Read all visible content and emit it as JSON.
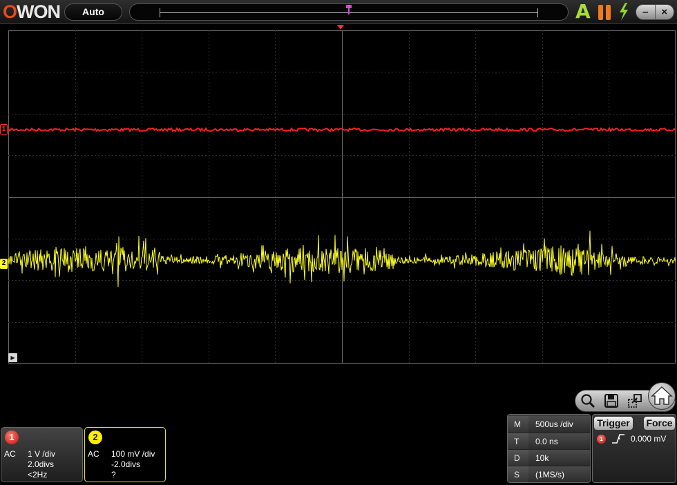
{
  "app": {
    "brand": "OWON"
  },
  "toolbar": {
    "mode_label": "Auto",
    "auto_icon_glyph": "A",
    "minimize_glyph": "–",
    "close_glyph": "×"
  },
  "colors": {
    "ch1": "#ff2020",
    "ch2": "#ffff20",
    "grid": "#2f2f2f",
    "grid_axis": "#6a6a6a",
    "background": "#000000",
    "trigger_marker": "#ff3030",
    "timebase_marker": "#d04fd0"
  },
  "icons": {
    "run_mode": "autoset-icon",
    "run_state": "pause-icon",
    "force": "lightning-icon",
    "zoom": "magnifier-icon",
    "save": "floppy-disk-icon",
    "export": "export-icon",
    "home": "home-icon",
    "trigger_edge": "rising-edge-icon"
  },
  "markers": {
    "ch1": "1",
    "ch2": "2",
    "play_glyph": "▶"
  },
  "channels": [
    {
      "number": "1",
      "coupling": "AC",
      "scale": "1 V /div",
      "position": "2.0divs",
      "frequency": "<2Hz"
    },
    {
      "number": "2",
      "coupling": "AC",
      "scale": "100 mV /div",
      "position": "-2.0divs",
      "frequency": "?"
    }
  ],
  "timebase": {
    "rows": [
      {
        "key": "M",
        "value": "500us /div"
      },
      {
        "key": "T",
        "value": "0.0 ns"
      },
      {
        "key": "D",
        "value": "10k"
      },
      {
        "key": "S",
        "value": "(1MS/s)"
      }
    ]
  },
  "trigger": {
    "trigger_label": "Trigger",
    "force_label": "Force",
    "source": "1",
    "level": "0.000 mV"
  }
}
